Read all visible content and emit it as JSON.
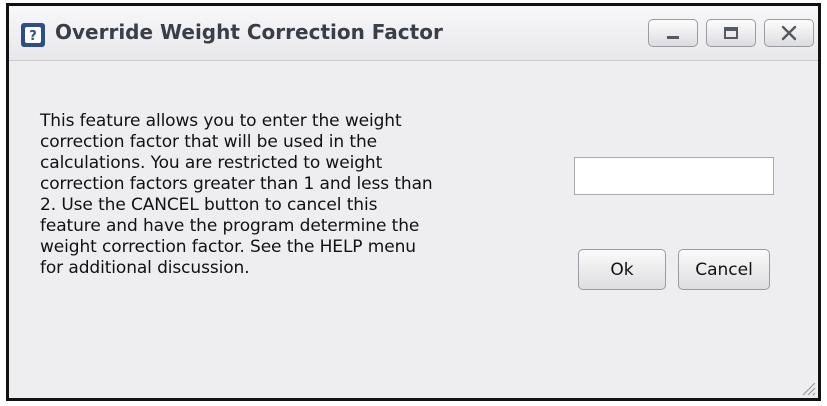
{
  "window": {
    "title": "Override Weight Correction Factor",
    "icon": "help-book-icon",
    "controls": {
      "minimize_icon": "minimize-icon",
      "maximize_icon": "maximize-icon",
      "close_icon": "close-icon"
    }
  },
  "dialog": {
    "message_lines": [
      "This feature allows you to enter the weight",
      "correction factor that will be used in the",
      "calculations. You are restricted to weight",
      "correction factors greater than 1 and less than",
      "2.  Use the CANCEL button to cancel this",
      "feature and have the program determine the",
      "weight correction factor.  See the HELP menu",
      "for additional discussion."
    ],
    "input": {
      "value": "",
      "placeholder": ""
    },
    "ok_label": "Ok",
    "cancel_label": "Cancel"
  },
  "colors": {
    "title_text": "#3a3f47",
    "dialog_background": "#eeeef0",
    "app_icon_background": "#2e4e88"
  }
}
